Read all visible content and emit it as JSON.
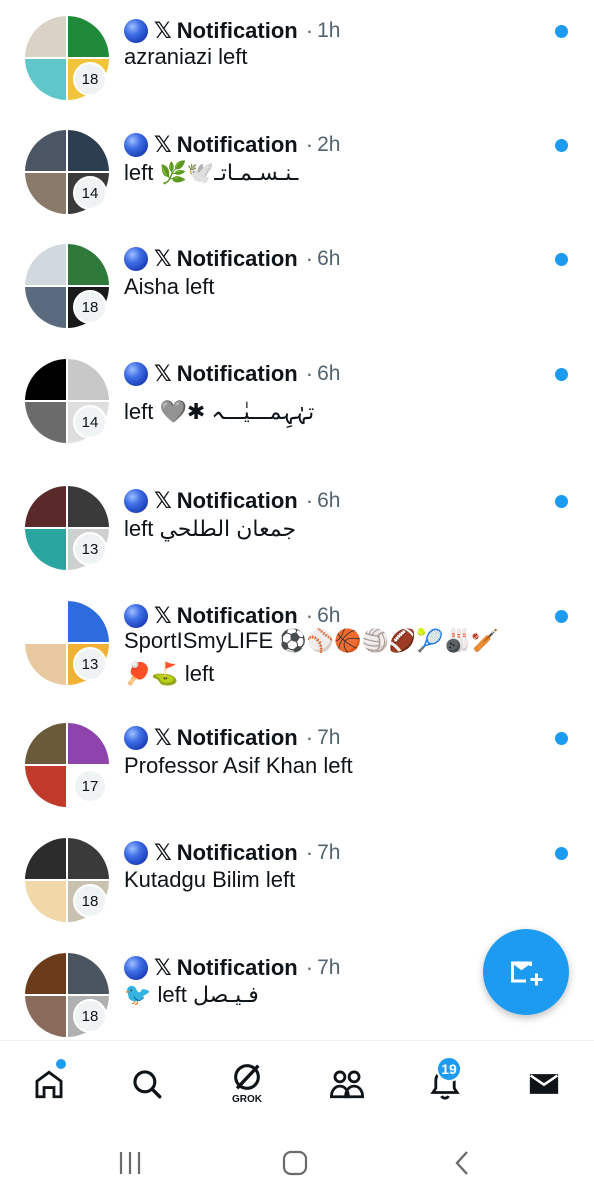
{
  "notifications": [
    {
      "title": "Notification",
      "time": "1h",
      "message": "azraniazi left",
      "count": "18",
      "unread": true,
      "avatar_colors": [
        "#d9d2c7",
        "#1e8a3a",
        "#5fc6c9",
        "#f2c43a"
      ]
    },
    {
      "title": "Notification",
      "time": "2h",
      "message": "left 🌿🕊️ـنـسـمـاتـ",
      "count": "14",
      "unread": true,
      "avatar_colors": [
        "#4b5563",
        "#2c3e50",
        "#8a7a6a",
        "#3a3a3a"
      ]
    },
    {
      "title": "Notification",
      "time": "6h",
      "message": "Aisha left",
      "count": "18",
      "unread": true,
      "avatar_colors": [
        "#cfd9de",
        "#2f7a3a",
        "#5a6b80",
        "#1a1a1a"
      ]
    },
    {
      "title": "Notification",
      "time": "6h",
      "message": "left 🩶✱ تہٰہِمـــیٰـــہ",
      "count": "14",
      "unread": true,
      "avatar_colors": [
        "#000000",
        "#c8c8c8",
        "#6b6b6b",
        "#dedede"
      ]
    },
    {
      "title": "Notification",
      "time": "6h",
      "message": "left جمعان الطلحي",
      "count": "13",
      "unread": true,
      "avatar_colors": [
        "#5a2a2a",
        "#3a3a3a",
        "#2aa5a0",
        "#cfcfcf"
      ]
    },
    {
      "title": "Notification",
      "time": "6h",
      "message": "SportISmyLIFE ⚽⚾🏀🏐🏈🎾🎳🏏🏓⛳ left",
      "count": "13",
      "unread": true,
      "avatar_colors": [
        "#ffffff",
        "#2d6cdf",
        "#e8c9a0",
        "#f2b134"
      ]
    },
    {
      "title": "Notification",
      "time": "7h",
      "message": "Professor Asif Khan left",
      "count": "17",
      "unread": true,
      "avatar_colors": [
        "#6b5a3a",
        "#8e44ad",
        "#c0392b",
        "#ffffff"
      ]
    },
    {
      "title": "Notification",
      "time": "7h",
      "message": "Kutadgu Bilim left",
      "count": "18",
      "unread": true,
      "avatar_colors": [
        "#2c2c2c",
        "#3a3a3a",
        "#f0d8a8",
        "#c9c1b0"
      ]
    },
    {
      "title": "Notification",
      "time": "7h",
      "message": "🐦 left فـيـصل",
      "count": "18",
      "unread": false,
      "avatar_colors": [
        "#6b3a1a",
        "#4a5560",
        "#8a6a5a",
        "#b0b0b0"
      ]
    }
  ],
  "nav": {
    "grok_label": "GROK",
    "notifications_badge": "19"
  },
  "icons": {
    "globe": "blue-circle-icon",
    "x": "x-logo-icon",
    "fab": "new-message-icon",
    "home": "home-icon",
    "search": "search-icon",
    "grok": "grok-icon",
    "communities": "communities-icon",
    "notifications": "bell-icon",
    "messages": "envelope-icon"
  },
  "colors": {
    "accent": "#1d9bf0",
    "text": "#0f1419",
    "secondary": "#536471"
  }
}
